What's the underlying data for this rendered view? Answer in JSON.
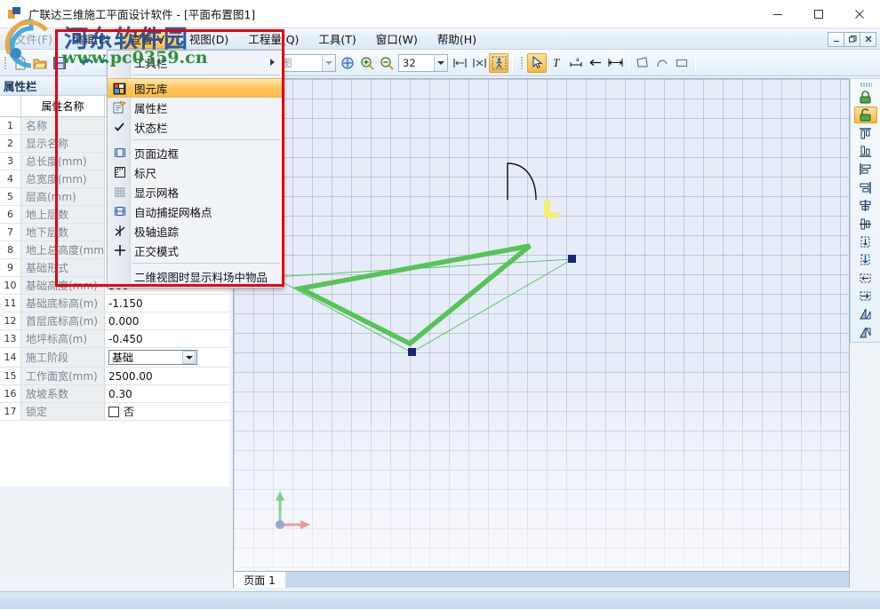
{
  "window": {
    "title": "广联达三维施工平面设计软件 - [平面布置图1]",
    "app_icon": "app-logo-icon",
    "minimize": "−",
    "maximize": "□",
    "close": "×",
    "mdi_minimize": "_",
    "mdi_restore": "❐",
    "mdi_close": "✕"
  },
  "menubar": {
    "items": [
      {
        "label": "文件(F)",
        "state": "dim"
      },
      {
        "label": "编辑(E)",
        "state": "normal"
      },
      {
        "label": "查看(V)",
        "state": "active"
      },
      {
        "label": "视图(D)",
        "state": "normal"
      },
      {
        "label": "工程量(Q)",
        "state": "normal"
      },
      {
        "label": "工具(T)",
        "state": "normal"
      },
      {
        "label": "窗口(W)",
        "state": "normal"
      },
      {
        "label": "帮助(H)",
        "state": "normal"
      }
    ]
  },
  "dropdown": {
    "owner": "查看(V)",
    "items": [
      {
        "label": "工具栏",
        "icon": "none",
        "submenu": true,
        "checked": false,
        "selected": false
      },
      {
        "label": "图元库",
        "icon": "element-library-icon",
        "submenu": false,
        "checked": false,
        "selected": true
      },
      {
        "label": "属性栏",
        "icon": "property-bar-icon",
        "submenu": false,
        "checked": false,
        "selected": false
      },
      {
        "label": "状态栏",
        "icon": "check-icon",
        "submenu": false,
        "checked": true,
        "selected": false
      },
      {
        "label": "页面边框",
        "icon": "page-border-icon",
        "submenu": false,
        "checked": false,
        "selected": false
      },
      {
        "label": "标尺",
        "icon": "ruler-icon",
        "submenu": false,
        "checked": false,
        "selected": false
      },
      {
        "label": "显示网格",
        "icon": "grid-icon",
        "submenu": false,
        "checked": false,
        "selected": false
      },
      {
        "label": "自动捕捉网格点",
        "icon": "snap-grid-icon",
        "submenu": false,
        "checked": false,
        "selected": false
      },
      {
        "label": "极轴追踪",
        "icon": "polar-track-icon",
        "submenu": false,
        "checked": false,
        "selected": false
      },
      {
        "label": "正交模式",
        "icon": "ortho-mode-icon",
        "submenu": false,
        "checked": false,
        "selected": false
      },
      {
        "label": "二维视图时显示料场中物品",
        "icon": "none",
        "submenu": false,
        "checked": false,
        "selected": false
      }
    ]
  },
  "toolbar": {
    "new_label": "new-file",
    "open_label": "open-file",
    "save_label": "save-file",
    "undo_label": "undo",
    "redo_label": "redo",
    "view_combo": {
      "value": "前视图",
      "arrow": "▼"
    },
    "scale_combo": {
      "value": "32",
      "arrow": "▼"
    }
  },
  "property_panel": {
    "title": "属性栏",
    "col_name": "属性名称",
    "rows": [
      {
        "n": "1",
        "name": "名称",
        "value": "",
        "type": "text"
      },
      {
        "n": "2",
        "name": "显示名称",
        "value": "",
        "type": "text"
      },
      {
        "n": "3",
        "name": "总长度(mm)",
        "value": "",
        "type": "text"
      },
      {
        "n": "4",
        "name": "总宽度(mm)",
        "value": "",
        "type": "text"
      },
      {
        "n": "5",
        "name": "层高(mm)",
        "value": "",
        "type": "text"
      },
      {
        "n": "6",
        "name": "地上层数",
        "value": "",
        "type": "text"
      },
      {
        "n": "7",
        "name": "地下层数",
        "value": "",
        "type": "text"
      },
      {
        "n": "8",
        "name": "地上总高度(mm)",
        "value": "",
        "type": "text"
      },
      {
        "n": "9",
        "name": "基础形式",
        "value": "",
        "type": "text"
      },
      {
        "n": "10",
        "name": "基础高度(mm)",
        "value": "500",
        "type": "text"
      },
      {
        "n": "11",
        "name": "基础底标高(m)",
        "value": "-1.150",
        "type": "text"
      },
      {
        "n": "12",
        "name": "首层底标高(m)",
        "value": "0.000",
        "type": "text"
      },
      {
        "n": "13",
        "name": "地坪标高(m)",
        "value": "-0.450",
        "type": "text"
      },
      {
        "n": "14",
        "name": "施工阶段",
        "value": "基础",
        "type": "select"
      },
      {
        "n": "15",
        "name": "工作面宽(mm)",
        "value": "2500.00",
        "type": "text"
      },
      {
        "n": "16",
        "name": "放坡系数",
        "value": "0.30",
        "type": "text"
      },
      {
        "n": "17",
        "name": "锁定",
        "value": "否",
        "type": "checkbox"
      }
    ]
  },
  "right_dock": {
    "buttons": [
      {
        "name": "lock-icon",
        "active": false
      },
      {
        "name": "unlock-icon",
        "active": true
      },
      {
        "name": "align-top-icon",
        "active": false
      },
      {
        "name": "align-bottom-icon",
        "active": false
      },
      {
        "name": "align-left-icon",
        "active": false
      },
      {
        "name": "align-right-icon",
        "active": false
      },
      {
        "name": "align-center-h-icon",
        "active": false
      },
      {
        "name": "align-center-v-icon",
        "active": false
      },
      {
        "name": "distribute-v-icon",
        "active": false
      },
      {
        "name": "space-v-icon",
        "active": false
      },
      {
        "name": "distribute-h-icon",
        "active": false
      },
      {
        "name": "space-h-icon",
        "active": false
      },
      {
        "name": "flip-h-icon",
        "active": false
      },
      {
        "name": "flip-v-icon",
        "active": false
      }
    ]
  },
  "page_tabs": {
    "tabs": [
      {
        "label": "页面 1",
        "active": true
      }
    ]
  },
  "watermark": {
    "text": "河东软件园",
    "url": "www.pc0359.cn"
  },
  "colors": {
    "accent_orange": "#fbbe4d",
    "selection_red": "#e8000d",
    "shape_green": "#5fc45f",
    "handle_navy": "#16257a",
    "canvas_blue": "#e6ecf8",
    "axis_green": "#00a21e",
    "axis_red": "#d61515",
    "marker_yellow": "#f2ea62"
  },
  "canvas": {
    "shape_note": "green-triangle-with-outline",
    "handles": 3,
    "axis_indicator": "origin-axes",
    "arc_shape": "black-arc-path",
    "yellow_marker": "yellow-corner-marker"
  }
}
